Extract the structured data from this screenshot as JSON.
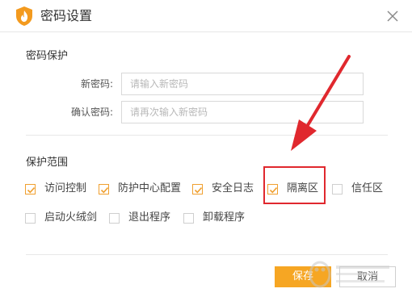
{
  "window": {
    "title": "密码设置"
  },
  "password_section": {
    "title": "密码保护",
    "new_password": {
      "label": "新密码:",
      "placeholder": "请输入新密码",
      "value": ""
    },
    "confirm_password": {
      "label": "确认密码:",
      "placeholder": "请再次输入新密码",
      "value": ""
    }
  },
  "scope_section": {
    "title": "保护范围",
    "options": [
      {
        "label": "访问控制",
        "checked": true
      },
      {
        "label": "防护中心配置",
        "checked": true
      },
      {
        "label": "安全日志",
        "checked": true
      },
      {
        "label": "隔离区",
        "checked": true
      },
      {
        "label": "信任区",
        "checked": false
      },
      {
        "label": "启动火绒剑",
        "checked": false
      },
      {
        "label": "退出程序",
        "checked": false
      },
      {
        "label": "卸载程序",
        "checked": false
      }
    ]
  },
  "buttons": {
    "save": "保存",
    "cancel": "取消"
  },
  "colors": {
    "accent": "#f6a623",
    "checkbox_checked": "#f0a030",
    "annotation_red": "#e0282e"
  },
  "icons": {
    "logo": "huorong-flame-icon",
    "close": "close-icon",
    "annotation_arrow": "red-arrow-icon"
  }
}
